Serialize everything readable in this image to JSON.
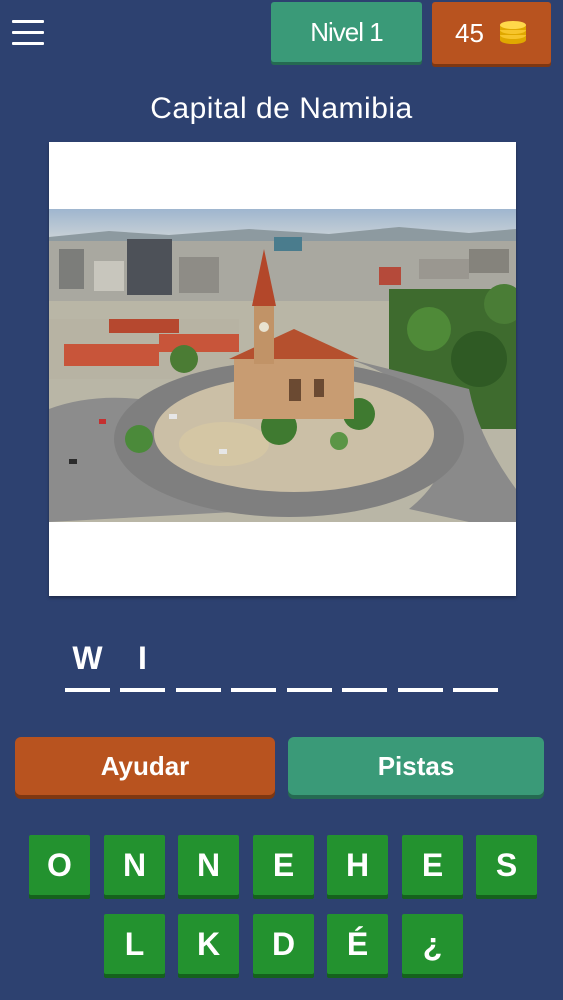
{
  "header": {
    "level_label": "Nivel 1",
    "coins": "45",
    "coin_icon": "coins-stack-icon",
    "menu_icon": "hamburger-menu-icon"
  },
  "question": {
    "title": "Capital de Namibia"
  },
  "answer": {
    "slots": [
      "W",
      "I",
      "",
      "",
      "",
      "",
      "",
      ""
    ]
  },
  "actions": {
    "help_label": "Ayudar",
    "hints_label": "Pistas"
  },
  "keyboard": {
    "row1": [
      "O",
      "N",
      "N",
      "E",
      "H",
      "E",
      "S"
    ],
    "row2": [
      "L",
      "K",
      "D",
      "É",
      "¿"
    ]
  },
  "colors": {
    "background": "#2d4170",
    "green_button": "#3a9a78",
    "orange_button": "#b8531f",
    "key_green": "#23922f"
  }
}
